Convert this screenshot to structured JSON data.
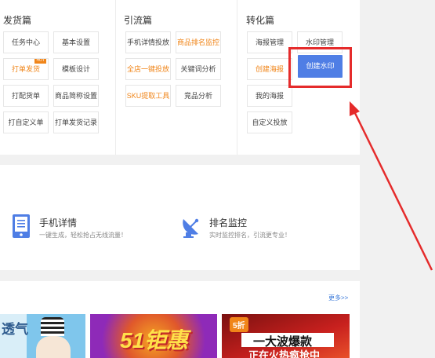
{
  "columns": [
    {
      "title": "发货篇",
      "buttons": [
        {
          "label": "任务中心",
          "orange": false
        },
        {
          "label": "基本设置",
          "orange": false
        },
        {
          "label": "打单发货",
          "orange": true,
          "hot": "HOT"
        },
        {
          "label": "模板设计",
          "orange": false
        },
        {
          "label": "打配货单",
          "orange": false
        },
        {
          "label": "商品简称设置",
          "orange": false
        },
        {
          "label": "打自定义单",
          "orange": false
        },
        {
          "label": "打单发货记录",
          "orange": false
        }
      ]
    },
    {
      "title": "引流篇",
      "buttons": [
        {
          "label": "手机详情投放",
          "orange": false
        },
        {
          "label": "商品排名监控",
          "orange": true
        },
        {
          "label": "全店一键投放",
          "orange": true
        },
        {
          "label": "关键词分析",
          "orange": false
        },
        {
          "label": "SKU提取工具",
          "orange": true
        },
        {
          "label": "竞品分析",
          "orange": false
        }
      ]
    },
    {
      "title": "转化篇",
      "buttons": [
        {
          "label": "海报管理",
          "orange": false
        },
        {
          "label": "水印管理",
          "orange": false
        },
        {
          "label": "创建海报",
          "orange": true
        },
        {
          "label": "我的海报",
          "orange": false
        },
        {
          "label": "自定义投放",
          "orange": false
        }
      ],
      "primary_button": "创建水印"
    }
  ],
  "features": [
    {
      "title": "手机详情",
      "desc": "一键生成，轻松抢占无线流量！",
      "icon": "mobile-icon"
    },
    {
      "title": "排名监控",
      "desc": "实时监控排名，引流更专业！",
      "icon": "satellite-dish-icon"
    }
  ],
  "more_link": "更多>>",
  "banners": [
    {
      "text": "透气"
    },
    {
      "text": "51钜惠"
    },
    {
      "badge": "5折",
      "line1": "一大波爆款",
      "line2": "正在火热疯抢中"
    }
  ],
  "colors": {
    "accent": "#4f7ee5",
    "orange": "#f08519",
    "highlight": "#e52b2b"
  }
}
